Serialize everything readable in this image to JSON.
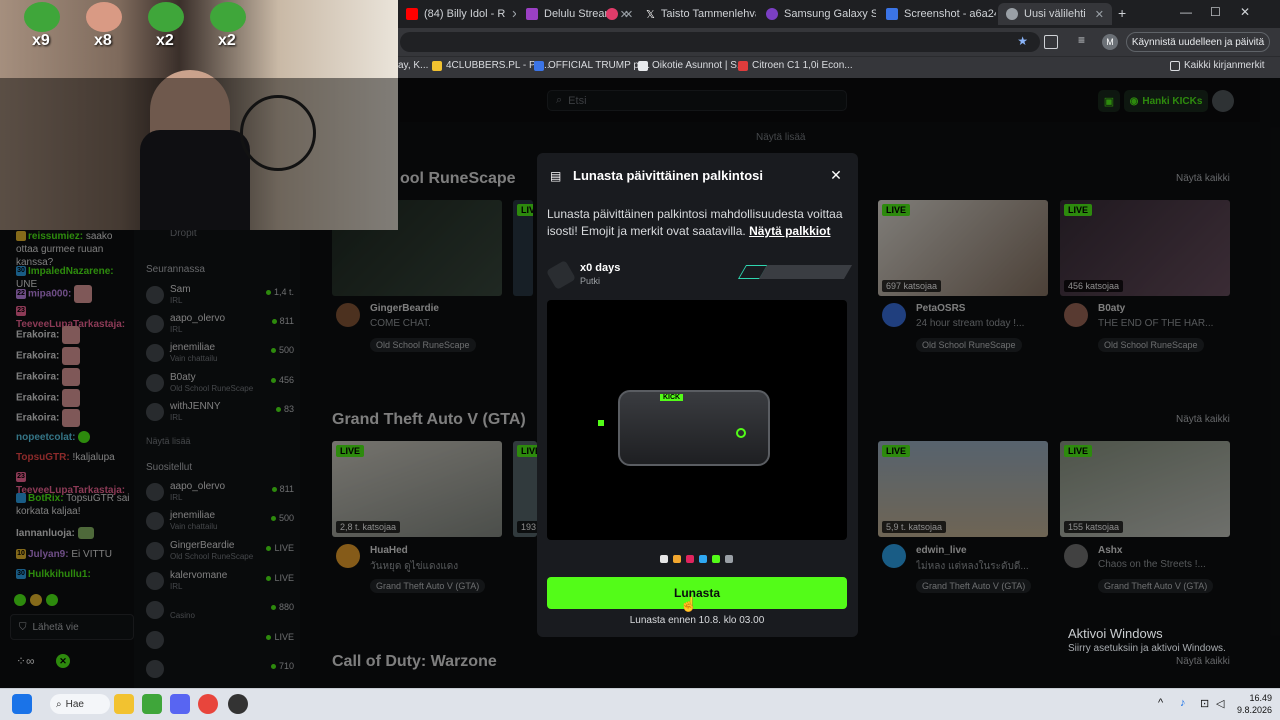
{
  "browser": {
    "tabs": [
      {
        "label": "(84) Billy Idol - R",
        "color": "#ff0000"
      },
      {
        "label": "Delulu Stream",
        "color": "#9b40c4"
      },
      {
        "label": "",
        "color": "#e03c6a"
      },
      {
        "label": "Taisto Tammenlehva",
        "color": "#000000"
      },
      {
        "label": "Samsung Galaxy S2",
        "color": "#7b3fc4"
      },
      {
        "label": "Screenshot - a6a24",
        "color": "#3b74e6"
      },
      {
        "label": "Uusi välilehti",
        "color": "#9aa0a6"
      }
    ],
    "restart_button": "Käynnistä uudelleen ja päivitä",
    "profile_initial": "M",
    "bookmarks": [
      {
        "label": "ay, K...",
        "color": "#dadce0"
      },
      {
        "label": "4CLUBBERS.PL - Po...",
        "color": "#f2c230"
      },
      {
        "label": "OFFICIAL TRUMP pr...",
        "color": "#3b74e6"
      },
      {
        "label": "Oikotie Asunnot | S...",
        "color": "#e8eaed"
      },
      {
        "label": "Citroen C1 1,0i Econ...",
        "color": "#e03c3c"
      }
    ],
    "bookmarks_all": "Kaikki kirjanmerkit"
  },
  "header": {
    "search_placeholder": "Etsi",
    "kicks_button": "Hanki KICKs",
    "show_more_top": "Näytä lisää"
  },
  "sections": [
    {
      "title": "Old School RuneScape",
      "title_visible": "ool RuneScape",
      "show_all": "Näytä kaikki",
      "streams": [
        {
          "name": "GingerBeardie",
          "title": "COME CHAT.",
          "tag": "Old School RuneScape",
          "viewers": "",
          "live": false
        },
        {
          "name": "PetaOSRS",
          "title": "24 hour stream today !...",
          "tag": "Old School RuneScape",
          "viewers": "697 katsojaa",
          "live": true
        },
        {
          "name": "B0aty",
          "title": "THE END OF THE HAR...",
          "tag": "Old School RuneScape",
          "viewers": "456 katsojaa",
          "live": true
        }
      ]
    },
    {
      "title": "Grand Theft Auto V (GTA)",
      "show_all": "Näytä kaikki",
      "streams": [
        {
          "name": "HuaHed",
          "title": "วันหยุด ดูไข่แดงแดง",
          "tag": "Grand Theft Auto V (GTA)",
          "viewers": "2,8 t. katsojaa",
          "live": true
        },
        {
          "name": "edwin_live",
          "title": "ไม่หลง แต่หลงในระดับดี...",
          "tag": "Grand Theft Auto V (GTA)",
          "viewers": "5,9 t. katsojaa",
          "live": true
        },
        {
          "name": "Ashx",
          "title": "Chaos on the Streets !...",
          "tag": "Grand Theft Auto V (GTA)",
          "viewers": "155 katsojaa",
          "live": true
        }
      ],
      "partial_viewers": "193"
    },
    {
      "title": "Call of Duty: Warzone",
      "show_all": "Näytä kaikki"
    }
  ],
  "sidebar": {
    "drops": "Dropit",
    "following_header": "Seurannassa",
    "following": [
      {
        "name": "Sam",
        "category": "IRL",
        "viewers": "1,4 t."
      },
      {
        "name": "aapo_olervo",
        "category": "IRL",
        "viewers": "811"
      },
      {
        "name": "jenemiliae",
        "category": "Vain chattailu",
        "viewers": "500"
      },
      {
        "name": "B0aty",
        "category": "Old School RuneScape",
        "viewers": "456"
      },
      {
        "name": "withJENNY",
        "category": "IRL",
        "viewers": "83"
      }
    ],
    "show_more": "Näytä lisää",
    "recommended_header": "Suositellut",
    "recommended": [
      {
        "name": "aapo_olervo",
        "category": "IRL",
        "viewers": "811"
      },
      {
        "name": "jenemiliae",
        "category": "Vain chattailu",
        "viewers": "500"
      },
      {
        "name": "GingerBeardie",
        "category": "Old School RuneScape",
        "viewers": "LIVE"
      },
      {
        "name": "kalervomane",
        "category": "IRL",
        "viewers": "LIVE"
      },
      {
        "name": "",
        "category": "Casino",
        "viewers": "880"
      },
      {
        "name": "",
        "category": "",
        "viewers": "LIVE"
      },
      {
        "name": "",
        "category": "",
        "viewers": "710"
      }
    ]
  },
  "webcam": {
    "multipliers": [
      "x9",
      "x8",
      "x2",
      "x2"
    ]
  },
  "chat": {
    "messages": [
      {
        "user": "reissumiez:",
        "text": "saako ottaa gurmee ruuan kanssa?",
        "color": "#53fc18",
        "badge": ""
      },
      {
        "user": "ImpaledNazarene:",
        "text": "UNE",
        "color": "#53fc18",
        "badge": "30"
      },
      {
        "user": "mipa000:",
        "text": "",
        "color": "#c98cf5",
        "badge": "22"
      },
      {
        "user": "TeeveeLupaTarkastaja:",
        "text": "",
        "color": "#ff6b9d",
        "badge": "23"
      },
      {
        "user": "Erakoira:",
        "text": "",
        "color": "#ffffff",
        "badge": ""
      },
      {
        "user": "Erakoira:",
        "text": "",
        "color": "#ffffff",
        "badge": ""
      },
      {
        "user": "Erakoira:",
        "text": "",
        "color": "#ffffff",
        "badge": ""
      },
      {
        "user": "Erakoira:",
        "text": "",
        "color": "#ffffff",
        "badge": ""
      },
      {
        "user": "Erakoira:",
        "text": "",
        "color": "#ffffff",
        "badge": ""
      },
      {
        "user": "nopeetcolat:",
        "text": "",
        "color": "#5fd3f3",
        "badge": ""
      },
      {
        "user": "TopsuGTR:",
        "text": "!kaljalupa",
        "color": "#ff4d4d",
        "badge": ""
      },
      {
        "user": "TeeveeLupaTarkastaja:",
        "text": "",
        "color": "#ff6b9d",
        "badge": "23"
      },
      {
        "user": "BotRix:",
        "text": "TopsuGTR sai korkata kaljaa!",
        "color": "#53fc18",
        "badge": ""
      },
      {
        "user": "Iannanluoja:",
        "text": "",
        "color": "#ffffff",
        "badge": ""
      },
      {
        "user": "Julyan9:",
        "text": "Ei VITTU",
        "color": "#c98cf5",
        "badge": "10"
      },
      {
        "user": "Hulkkihullu1:",
        "text": "",
        "color": "#53fc18",
        "badge": "30"
      }
    ],
    "input_placeholder": "Lähetä vie"
  },
  "modal": {
    "title": "Lunasta päivittäinen palkintosi",
    "description": "Lunasta päivittäinen palkintosi mahdollisuudesta voittaa isosti! Emojit ja merkit ovat saatavilla.",
    "link": "Näytä palkkiot",
    "streak_label": "x0 days",
    "streak_sub": "Putki",
    "streak_filled": 1,
    "streak_total": 5,
    "color_options": [
      "#e6e6e6",
      "#f2a72f",
      "#e0245e",
      "#2fa8f2",
      "#53fc18",
      "#9aa0a6"
    ],
    "claim_button": "Lunasta",
    "deadline": "Lunasta ennen 10.8. klo 03.00",
    "device_label": "KICK"
  },
  "activate_windows": {
    "title": "Aktivoi Windows",
    "subtitle": "Siirry asetuksiin ja aktivoi Windows."
  },
  "taskbar": {
    "search": "Hae",
    "time": "16.49",
    "date": "9.8.2026"
  },
  "colors": {
    "accent": "#53fc18",
    "modal_bg": "#191b1f",
    "page_bg": "#0e1012"
  }
}
